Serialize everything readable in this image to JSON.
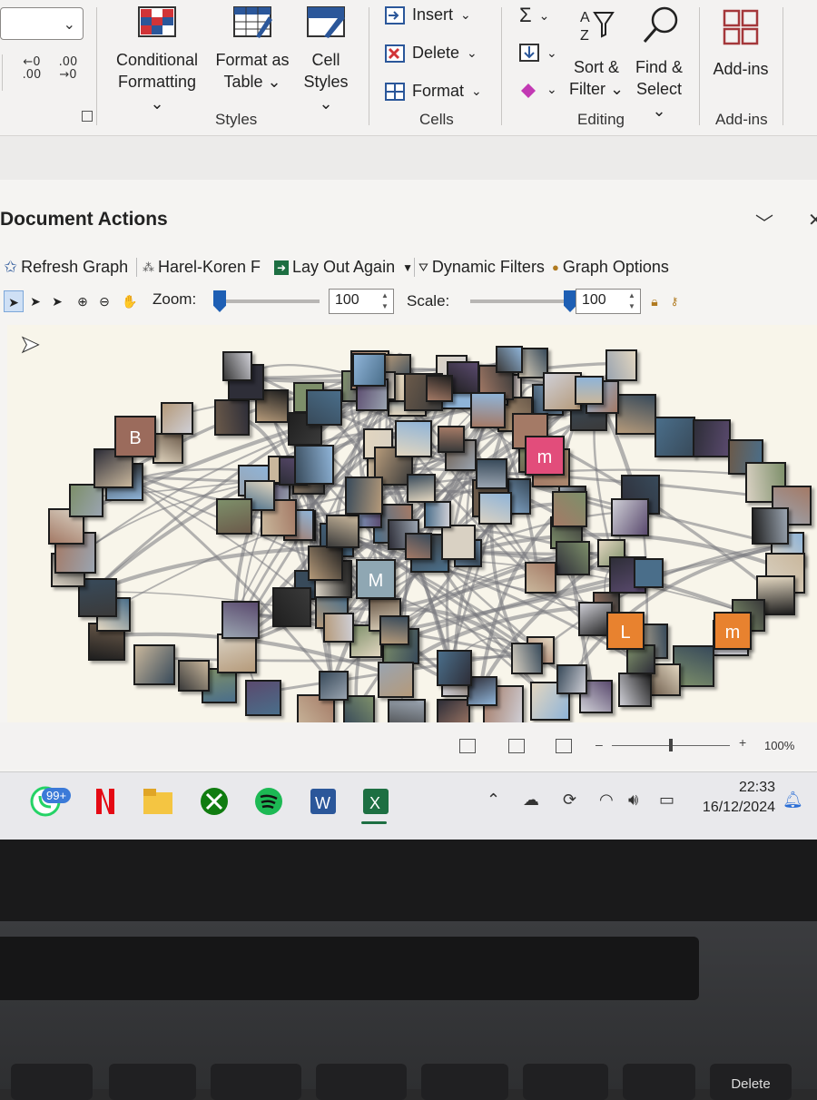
{
  "ribbon": {
    "decimal_increase": "←0\n.00",
    "decimal_decrease": ".00\n→0",
    "styles": {
      "conditional_formatting": [
        "Conditional",
        "Formatting ⌄"
      ],
      "format_as_table": [
        "Format as",
        "Table ⌄"
      ],
      "cell_styles": [
        "Cell",
        "Styles ⌄"
      ],
      "group_label": "Styles"
    },
    "cells": {
      "insert": "Insert",
      "delete": "Delete",
      "format": "Format",
      "group_label": "Cells"
    },
    "editing": {
      "sort_filter": [
        "Sort &",
        "Filter ⌄"
      ],
      "find_select": [
        "Find &",
        "Select ⌄"
      ],
      "group_label": "Editing"
    },
    "addins": {
      "addins": "Add-ins",
      "group_label": "Add-ins"
    }
  },
  "pane": {
    "title": "Document Actions",
    "toolbar": {
      "refresh_graph": "Refresh Graph",
      "layout_name": "Harel-Koren F",
      "lay_out_again": "Lay Out Again",
      "dynamic_filters": "Dynamic Filters",
      "graph_options": "Graph Options"
    },
    "zoom": {
      "label": "Zoom:",
      "value": "100",
      "level": 0
    },
    "scale": {
      "label": "Scale:",
      "value": "100",
      "level": 1
    },
    "node_letters": [
      "B",
      "m",
      "M",
      "L",
      "m"
    ]
  },
  "statusbar": {
    "zoom_percent": "100%"
  },
  "taskbar": {
    "whatsapp_badge": "99+",
    "time": "22:33",
    "date": "16/12/2024"
  },
  "keyboard": {
    "delete_key": "Delete"
  },
  "colors": {
    "accent": "#1e5fb4",
    "excel_green": "#1d6f42",
    "node_pink": "#e24d7b",
    "node_orange": "#e8822f",
    "node_brown": "#9b6b5c",
    "node_steel": "#8fa7b3"
  }
}
